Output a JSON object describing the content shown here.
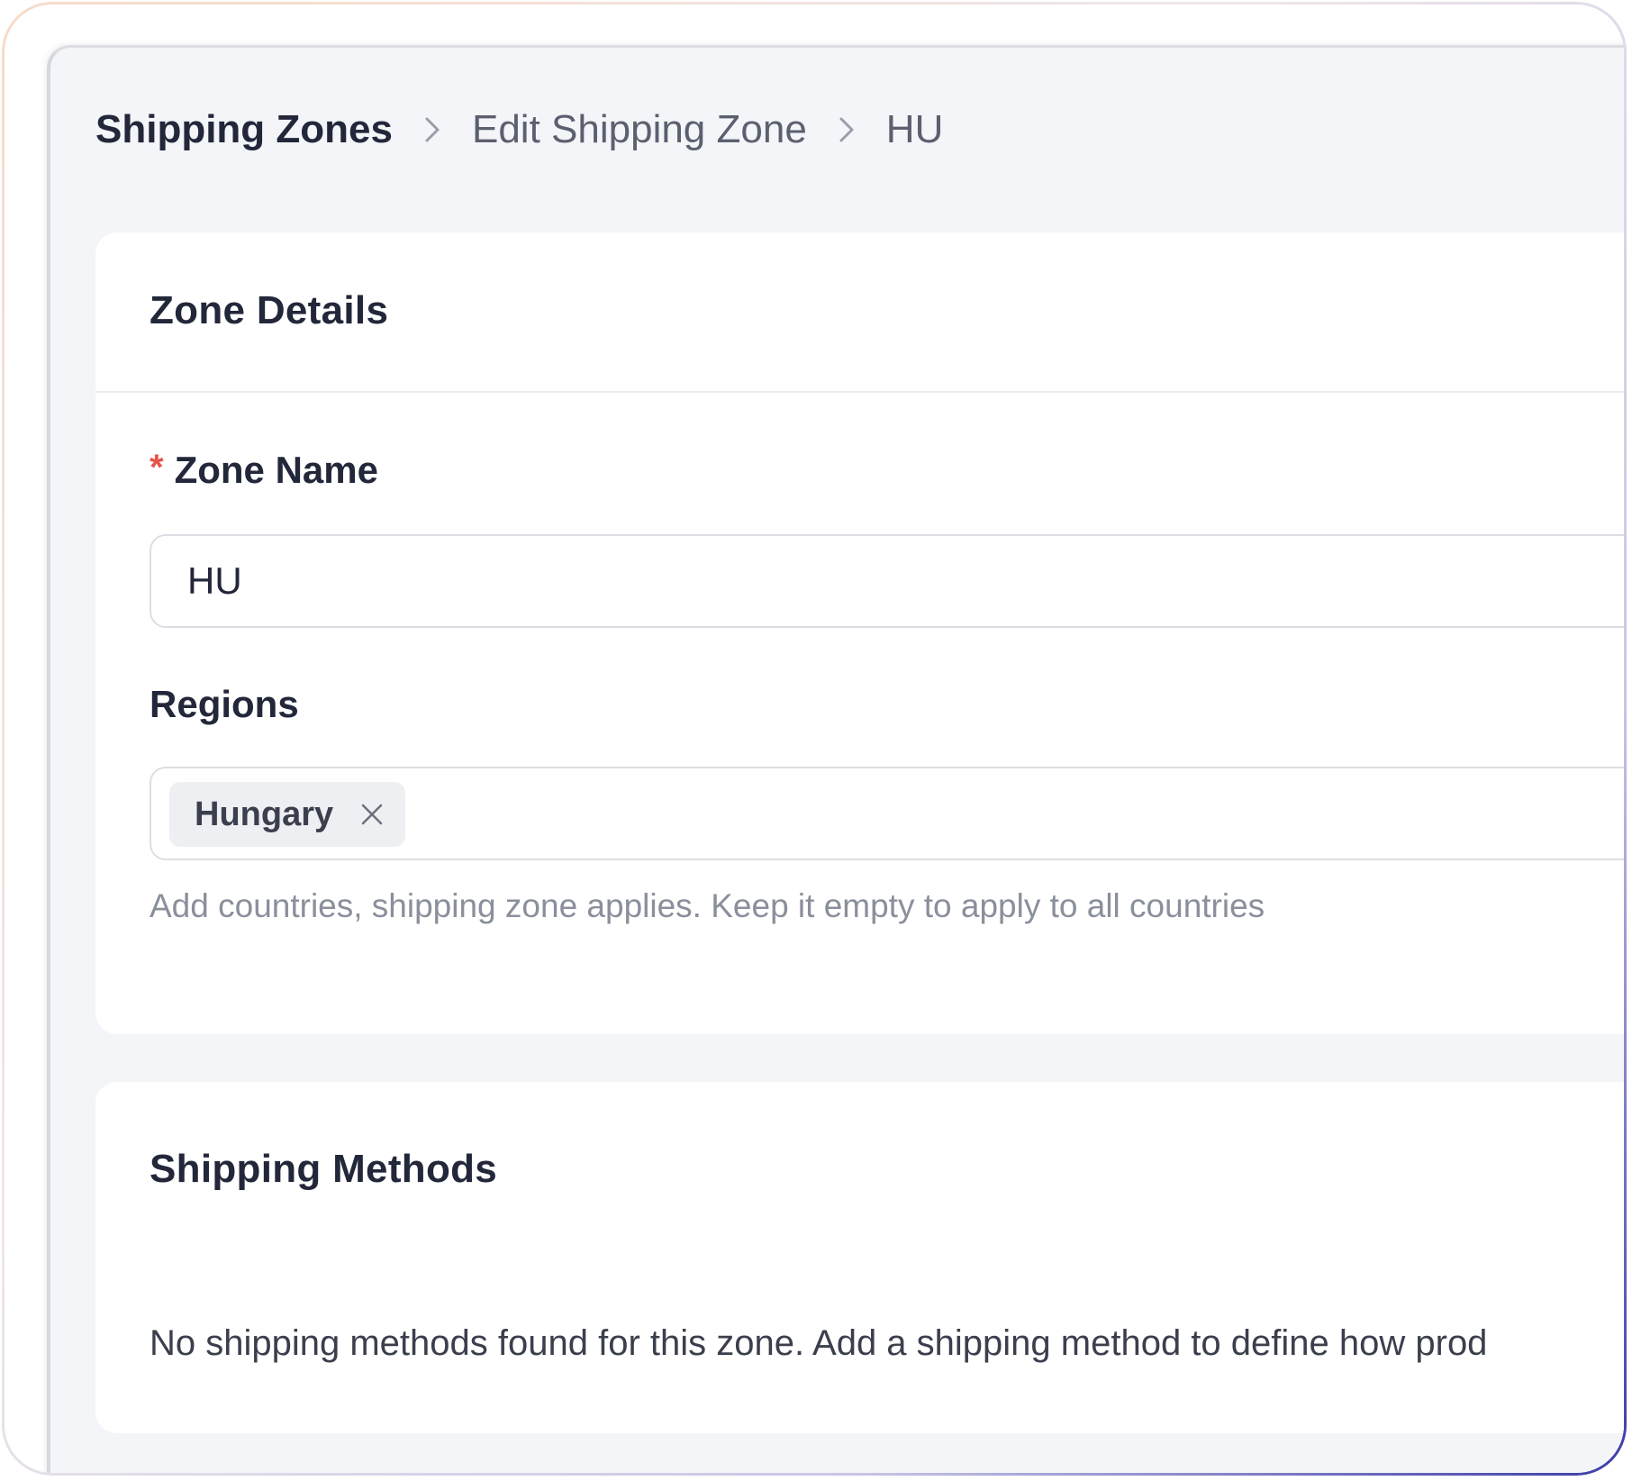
{
  "breadcrumb": {
    "root": "Shipping Zones",
    "middle": "Edit Shipping Zone",
    "current": "HU"
  },
  "zone_details": {
    "title": "Zone Details",
    "zone_name": {
      "label": "Zone Name",
      "required_marker": "*",
      "value": "HU"
    },
    "regions": {
      "label": "Regions",
      "tags": [
        {
          "label": "Hungary",
          "remove_icon": "close-icon"
        }
      ],
      "help_text": "Add countries, shipping zone applies. Keep it empty to apply to all countries"
    }
  },
  "shipping_methods": {
    "title": "Shipping Methods",
    "empty_message": "No shipping methods found for this zone. Add a shipping method to define how prod"
  },
  "colors": {
    "page_background": "#f4f5f8",
    "card_background": "#ffffff",
    "required": "#e5534b",
    "heading": "#22273a",
    "muted": "#8a8f9c"
  }
}
